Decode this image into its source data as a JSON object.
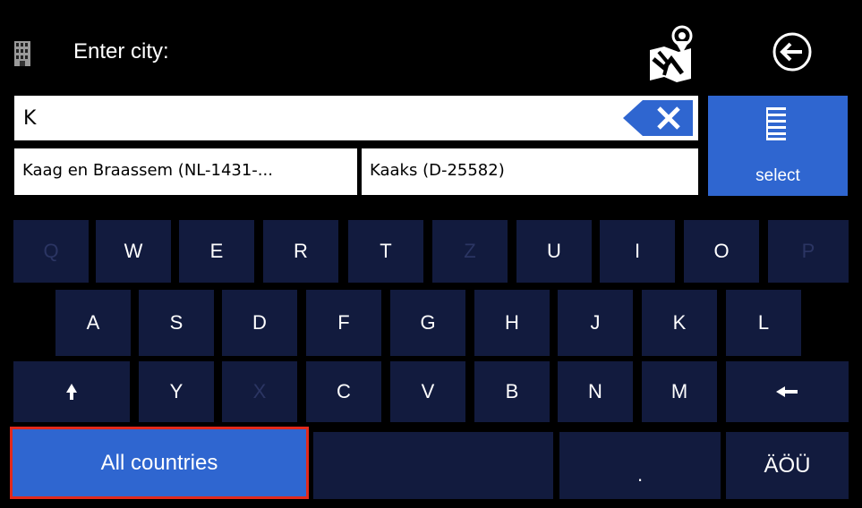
{
  "header": {
    "title": "Enter city:"
  },
  "search": {
    "value": "K"
  },
  "suggestions": [
    "Kaag en Braassem (NL-1431-...",
    "Kaaks (D-25582)"
  ],
  "select_button": {
    "label": "select"
  },
  "keyboard": {
    "row1": [
      {
        "label": "Q",
        "enabled": false
      },
      {
        "label": "W",
        "enabled": true
      },
      {
        "label": "E",
        "enabled": true
      },
      {
        "label": "R",
        "enabled": true
      },
      {
        "label": "T",
        "enabled": true
      },
      {
        "label": "Z",
        "enabled": false
      },
      {
        "label": "U",
        "enabled": true
      },
      {
        "label": "I",
        "enabled": true
      },
      {
        "label": "O",
        "enabled": true
      },
      {
        "label": "P",
        "enabled": false
      }
    ],
    "row2": [
      {
        "label": "A",
        "enabled": true
      },
      {
        "label": "S",
        "enabled": true
      },
      {
        "label": "D",
        "enabled": true
      },
      {
        "label": "F",
        "enabled": true
      },
      {
        "label": "G",
        "enabled": true
      },
      {
        "label": "H",
        "enabled": true
      },
      {
        "label": "J",
        "enabled": true
      },
      {
        "label": "K",
        "enabled": true
      },
      {
        "label": "L",
        "enabled": true
      }
    ],
    "row3": [
      {
        "label": "Y",
        "enabled": true
      },
      {
        "label": "X",
        "enabled": false
      },
      {
        "label": "C",
        "enabled": true
      },
      {
        "label": "V",
        "enabled": true
      },
      {
        "label": "B",
        "enabled": true
      },
      {
        "label": "N",
        "enabled": true
      },
      {
        "label": "M",
        "enabled": true
      }
    ],
    "row4": {
      "all_countries": "All countries",
      "period": ".",
      "umlaut": "ÄÖÜ"
    }
  },
  "icons": {
    "building": "building-icon",
    "map": "map-pin-icon",
    "back": "back-arrow-icon",
    "clear": "clear-input-icon",
    "select": "list-icon",
    "shift": "shift-icon",
    "backspace": "backspace-icon"
  },
  "colors": {
    "accent": "#2f66d0",
    "key_bg": "#121b3e",
    "key_disabled_text": "#2b3563",
    "highlight_border": "#e22a1c"
  }
}
